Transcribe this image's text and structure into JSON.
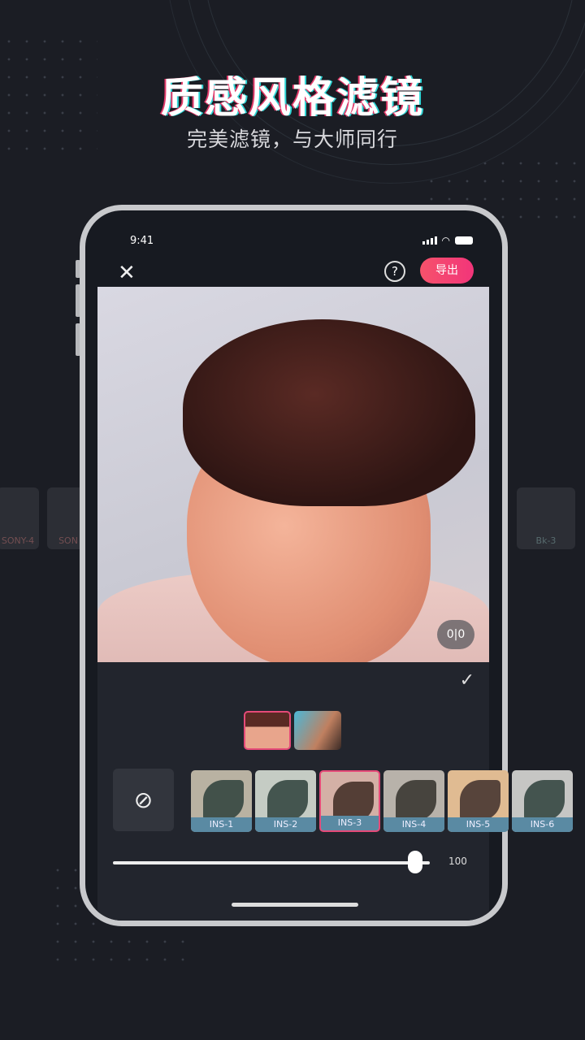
{
  "headline": "质感风格滤镜",
  "subheadline": "完美滤镜，与大师同行",
  "side_filters": {
    "left": [
      "SONY-4",
      "SON"
    ],
    "right": [
      "Bk-3"
    ]
  },
  "status_bar": {
    "time": "9:41"
  },
  "toolbar": {
    "close_icon": "close-icon",
    "help_label": "?",
    "export_label": "导出"
  },
  "compare_label": "0|0",
  "filters": [
    {
      "label": "INS-1",
      "color": "#b9b2a2"
    },
    {
      "label": "INS-2",
      "color": "#c5ccc4"
    },
    {
      "label": "INS-3",
      "color": "#d4b0a6",
      "selected": true
    },
    {
      "label": "INS-4",
      "color": "#b8b2aa"
    },
    {
      "label": "INS-5",
      "color": "#e0bb92"
    },
    {
      "label": "INS-6",
      "color": "#c6c6c4"
    }
  ],
  "intensity": {
    "value": 100,
    "label": "100"
  },
  "colors": {
    "accent": "#f2357a",
    "background": "#1b1d24",
    "label_bg": "#5a8aa3"
  }
}
